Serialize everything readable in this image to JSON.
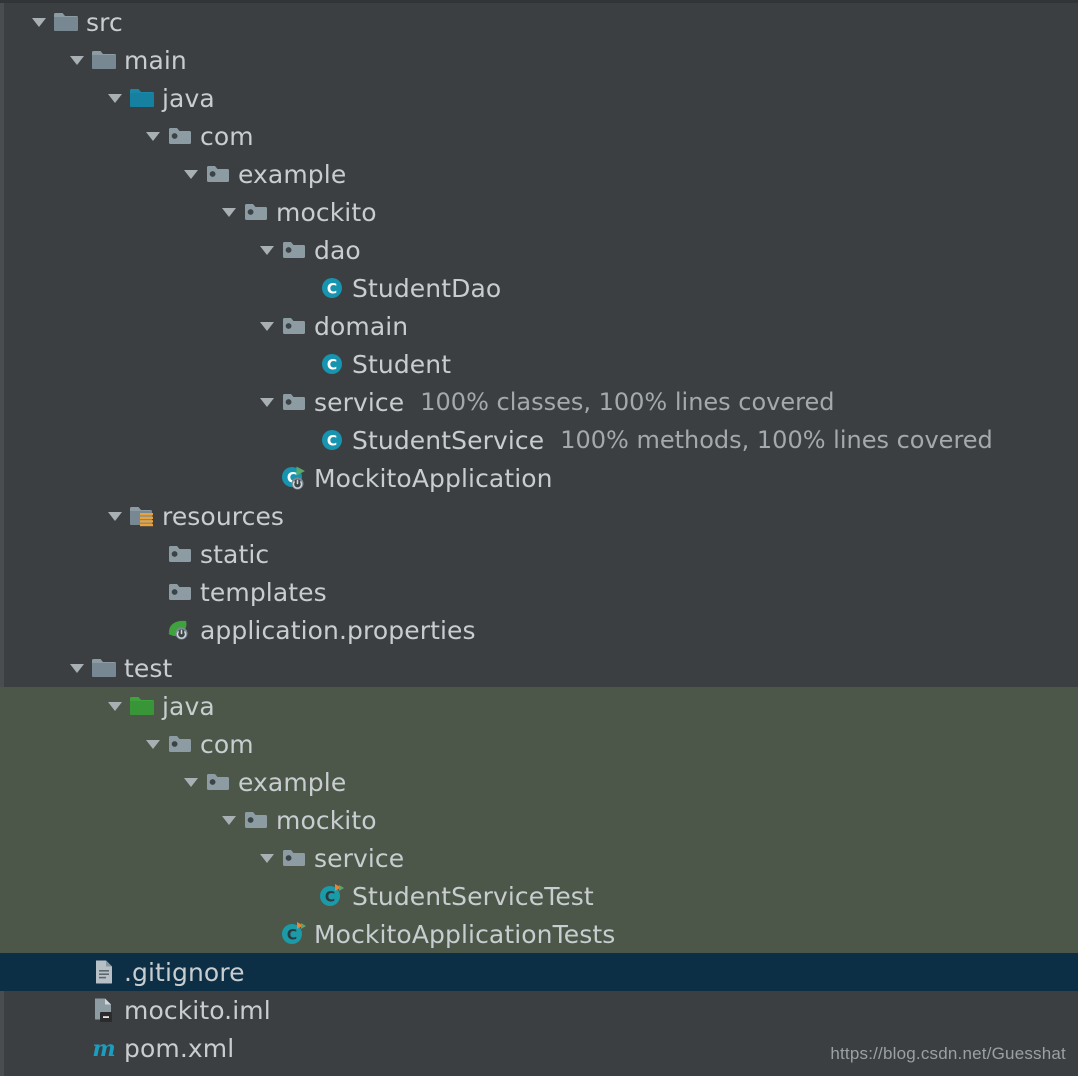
{
  "panel": {
    "name": "project-tree",
    "background_color": "#3c3f41",
    "test_scope_color": "#4c5749",
    "selection_color": "#0d2f46",
    "text_color": "#c8cdd0",
    "coverage_text_color": "#a3a9ac",
    "source_folder_color": "#1a87a8",
    "test_folder_color": "#3fa23f",
    "class_icon_color": "#1694b0"
  },
  "watermark": "https://blog.csdn.net/Guesshat",
  "rows": [
    {
      "label": "src",
      "icon": "folder-icon",
      "depth": 0,
      "expanded": true,
      "coverage": "",
      "scope": "main",
      "selected": false
    },
    {
      "label": "main",
      "icon": "folder-icon",
      "depth": 1,
      "expanded": true,
      "coverage": "",
      "scope": "main",
      "selected": false
    },
    {
      "label": "java",
      "icon": "source-folder-icon",
      "depth": 2,
      "expanded": true,
      "coverage": "",
      "scope": "main",
      "selected": false
    },
    {
      "label": "com",
      "icon": "package-icon",
      "depth": 3,
      "expanded": true,
      "coverage": "",
      "scope": "main",
      "selected": false
    },
    {
      "label": "example",
      "icon": "package-icon",
      "depth": 4,
      "expanded": true,
      "coverage": "",
      "scope": "main",
      "selected": false
    },
    {
      "label": "mockito",
      "icon": "package-icon",
      "depth": 5,
      "expanded": true,
      "coverage": "",
      "scope": "main",
      "selected": false
    },
    {
      "label": "dao",
      "icon": "package-icon",
      "depth": 6,
      "expanded": true,
      "coverage": "",
      "scope": "main",
      "selected": false
    },
    {
      "label": "StudentDao",
      "icon": "class-icon",
      "depth": 7,
      "expanded": null,
      "coverage": "",
      "scope": "main",
      "selected": false
    },
    {
      "label": "domain",
      "icon": "package-icon",
      "depth": 6,
      "expanded": true,
      "coverage": "",
      "scope": "main",
      "selected": false
    },
    {
      "label": "Student",
      "icon": "class-icon",
      "depth": 7,
      "expanded": null,
      "coverage": "",
      "scope": "main",
      "selected": false
    },
    {
      "label": "service",
      "icon": "package-icon",
      "depth": 6,
      "expanded": true,
      "coverage": "100% classes, 100% lines covered",
      "scope": "main",
      "selected": false
    },
    {
      "label": "StudentService",
      "icon": "class-icon",
      "depth": 7,
      "expanded": null,
      "coverage": "100% methods, 100% lines covered",
      "scope": "main",
      "selected": false
    },
    {
      "label": "MockitoApplication",
      "icon": "spring-boot-class-icon",
      "depth": 6,
      "expanded": null,
      "coverage": "",
      "scope": "main",
      "selected": false
    },
    {
      "label": "resources",
      "icon": "resource-folder-icon",
      "depth": 2,
      "expanded": true,
      "coverage": "",
      "scope": "main",
      "selected": false
    },
    {
      "label": "static",
      "icon": "package-icon",
      "depth": 3,
      "expanded": null,
      "coverage": "",
      "scope": "main",
      "selected": false
    },
    {
      "label": "templates",
      "icon": "package-icon",
      "depth": 3,
      "expanded": null,
      "coverage": "",
      "scope": "main",
      "selected": false
    },
    {
      "label": "application.properties",
      "icon": "spring-properties-icon",
      "depth": 3,
      "expanded": null,
      "coverage": "",
      "scope": "main",
      "selected": false
    },
    {
      "label": "test",
      "icon": "folder-icon",
      "depth": 1,
      "expanded": true,
      "coverage": "",
      "scope": "main",
      "selected": false
    },
    {
      "label": "java",
      "icon": "test-folder-icon",
      "depth": 2,
      "expanded": true,
      "coverage": "",
      "scope": "test",
      "selected": false
    },
    {
      "label": "com",
      "icon": "package-icon",
      "depth": 3,
      "expanded": true,
      "coverage": "",
      "scope": "test",
      "selected": false
    },
    {
      "label": "example",
      "icon": "package-icon",
      "depth": 4,
      "expanded": true,
      "coverage": "",
      "scope": "test",
      "selected": false
    },
    {
      "label": "mockito",
      "icon": "package-icon",
      "depth": 5,
      "expanded": true,
      "coverage": "",
      "scope": "test",
      "selected": false
    },
    {
      "label": "service",
      "icon": "package-icon",
      "depth": 6,
      "expanded": true,
      "coverage": "",
      "scope": "test",
      "selected": false
    },
    {
      "label": "StudentServiceTest",
      "icon": "test-class-icon",
      "depth": 7,
      "expanded": null,
      "coverage": "",
      "scope": "test",
      "selected": false
    },
    {
      "label": "MockitoApplicationTests",
      "icon": "test-class-icon",
      "depth": 6,
      "expanded": null,
      "coverage": "",
      "scope": "test",
      "selected": false
    },
    {
      "label": ".gitignore",
      "icon": "text-file-icon",
      "depth": 1,
      "expanded": null,
      "coverage": "",
      "scope": "main",
      "selected": true
    },
    {
      "label": "mockito.iml",
      "icon": "iml-file-icon",
      "depth": 1,
      "expanded": null,
      "coverage": "",
      "scope": "main",
      "selected": false
    },
    {
      "label": "pom.xml",
      "icon": "maven-icon",
      "depth": 1,
      "expanded": null,
      "coverage": "",
      "scope": "main",
      "selected": false
    }
  ]
}
